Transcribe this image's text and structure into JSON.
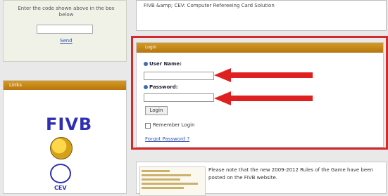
{
  "verify": {
    "instruction": "Enter the code shown above in the box below",
    "code_value": "",
    "send_link": "Send"
  },
  "links_panel": {
    "title": "Links",
    "fivb_logo": "FIVB",
    "cev_logo": "CEV"
  },
  "top_right": {
    "text": "FIVB &amp; CEV: Computer Refereeing Card Solution"
  },
  "login": {
    "title": "Login",
    "username_label": "User Name:",
    "username_value": "",
    "password_label": "Password:",
    "password_value": "",
    "login_button": "Login",
    "remember_label": "Remember Login",
    "forgot_link": "Forgot Password ?"
  },
  "news": {
    "text": "Please note that the new 2009-2012 Rules of the Game have been posted on the FIVB website."
  },
  "colors": {
    "accent_header": "#c8861a",
    "highlight_outline": "#d42a2a",
    "arrow": "#e02020"
  },
  "icons": [
    "user-name-icon",
    "password-icon",
    "arrow-icon",
    "fivb-logo",
    "volleyball-logo",
    "cev-logo"
  ]
}
